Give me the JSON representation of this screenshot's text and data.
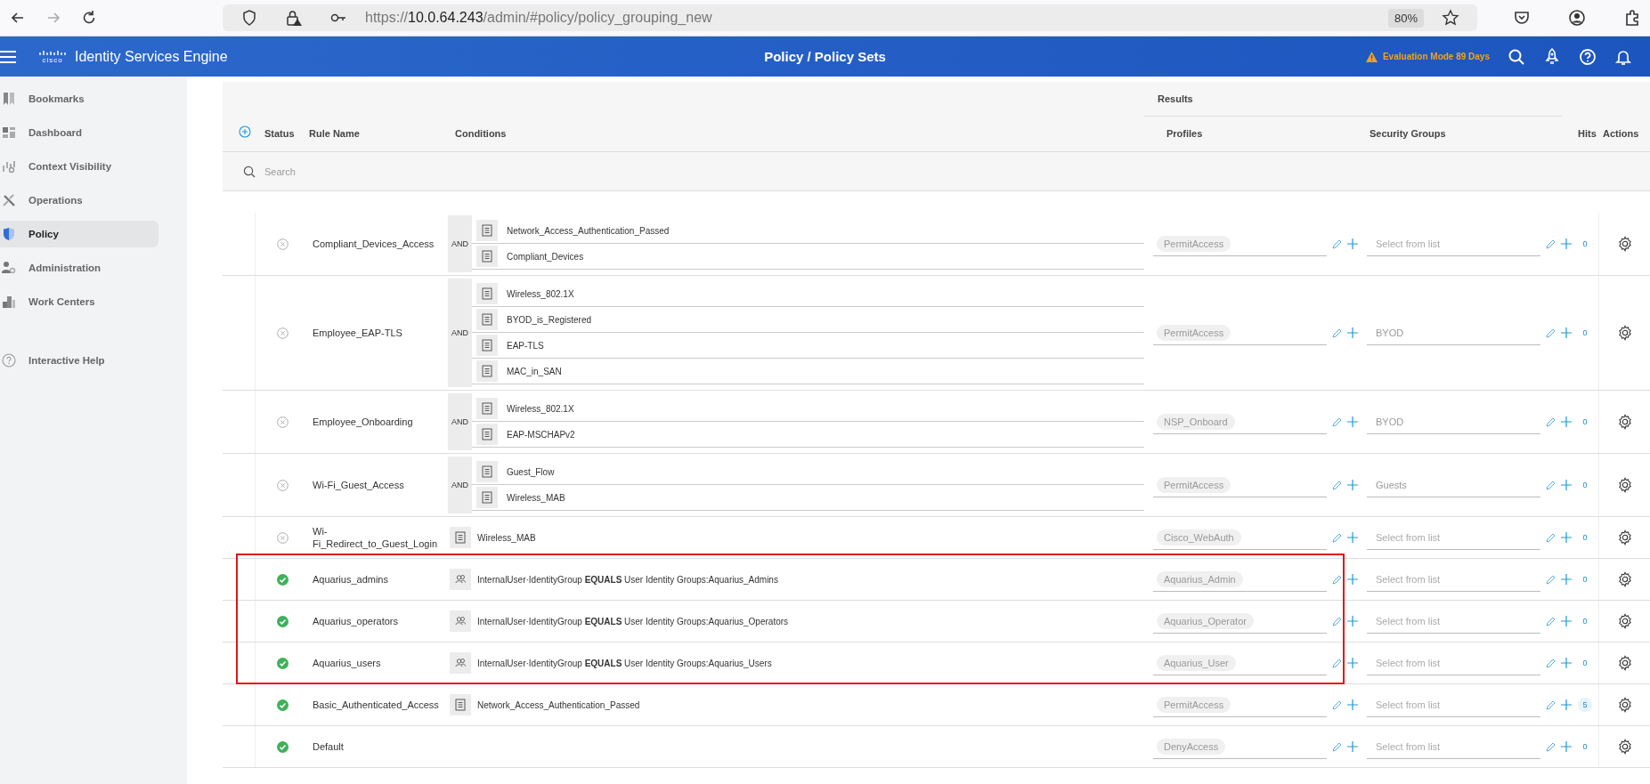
{
  "browser": {
    "url_scheme": "https://",
    "url_host": "10.0.64.243",
    "url_path": "/admin/#policy/policy_grouping_new",
    "zoom": "80%"
  },
  "header": {
    "logo_text": "cisco",
    "product": "Identity Services Engine",
    "title": "Policy / Policy Sets",
    "notice": "Evaluation Mode 89 Days"
  },
  "sidebar": {
    "items": [
      {
        "label": "Bookmarks",
        "selected": false
      },
      {
        "label": "Dashboard",
        "selected": false
      },
      {
        "label": "Context Visibility",
        "selected": false
      },
      {
        "label": "Operations",
        "selected": false
      },
      {
        "label": "Policy",
        "selected": true
      },
      {
        "label": "Administration",
        "selected": false
      },
      {
        "label": "Work Centers",
        "selected": false
      }
    ],
    "help": "Interactive Help"
  },
  "table": {
    "group_heading": "Results",
    "columns": [
      "Status",
      "Rule Name",
      "Conditions",
      "Profiles",
      "Security Groups",
      "Hits",
      "Actions"
    ],
    "search": {
      "placeholder": "Search"
    },
    "rows": [
      {
        "enabled": false,
        "highlighted": false,
        "name": "Compliant_Devices_Access",
        "conditions": {
          "kind": "and",
          "operator": "AND",
          "items": [
            "Network_Access_Authentication_Passed",
            "Compliant_Devices"
          ]
        },
        "profile": "PermitAccess",
        "security_group": {
          "placeholder": "Select from list"
        },
        "hits": "0"
      },
      {
        "enabled": false,
        "highlighted": false,
        "name": "Employee_EAP-TLS",
        "conditions": {
          "kind": "and",
          "operator": "AND",
          "items": [
            "Wireless_802.1X",
            "BYOD_is_Registered",
            "EAP-TLS",
            "MAC_in_SAN"
          ]
        },
        "profile": "PermitAccess",
        "security_group": {
          "value": "BYOD"
        },
        "hits": "0"
      },
      {
        "enabled": false,
        "highlighted": false,
        "name": "Employee_Onboarding",
        "conditions": {
          "kind": "and",
          "operator": "AND",
          "items": [
            "Wireless_802.1X",
            "EAP-MSCHAPv2"
          ]
        },
        "profile": "NSP_Onboard",
        "security_group": {
          "value": "BYOD"
        },
        "hits": "0"
      },
      {
        "enabled": false,
        "highlighted": false,
        "name": "Wi-Fi_Guest_Access",
        "conditions": {
          "kind": "and",
          "operator": "AND",
          "items": [
            "Guest_Flow",
            "Wireless_MAB"
          ]
        },
        "profile": "PermitAccess",
        "security_group": {
          "value": "Guests"
        },
        "hits": "0"
      },
      {
        "enabled": false,
        "highlighted": false,
        "name": "Wi-Fi_Redirect_to_Guest_Login",
        "conditions": {
          "kind": "single",
          "items": [
            "Wireless_MAB"
          ]
        },
        "profile": "Cisco_WebAuth",
        "security_group": {
          "placeholder": "Select from list"
        },
        "hits": "0"
      },
      {
        "enabled": true,
        "highlighted": true,
        "name": "Aquarius_admins",
        "conditions": {
          "kind": "identity",
          "text": "InternalUser·IdentityGroup **EQUALS** User Identity Groups:Aquarius_Admins"
        },
        "profile": "Aquarius_Admin",
        "security_group": {
          "placeholder": "Select from list"
        },
        "hits": "0"
      },
      {
        "enabled": true,
        "highlighted": true,
        "name": "Aquarius_operators",
        "conditions": {
          "kind": "identity",
          "text": "InternalUser·IdentityGroup **EQUALS** User Identity Groups:Aquarius_Operators"
        },
        "profile": "Aquarius_Operator",
        "security_group": {
          "placeholder": "Select from list"
        },
        "hits": "0"
      },
      {
        "enabled": true,
        "highlighted": true,
        "name": "Aquarius_users",
        "conditions": {
          "kind": "identity",
          "text": "InternalUser·IdentityGroup **EQUALS** User Identity Groups:Aquarius_Users"
        },
        "profile": "Aquarius_User",
        "security_group": {
          "placeholder": "Select from list"
        },
        "hits": "0"
      },
      {
        "enabled": true,
        "highlighted": false,
        "name": "Basic_Authenticated_Access",
        "conditions": {
          "kind": "single",
          "items": [
            "Network_Access_Authentication_Passed"
          ]
        },
        "profile": "PermitAccess",
        "security_group": {
          "placeholder": "Select from list"
        },
        "hits": "5"
      },
      {
        "enabled": true,
        "highlighted": false,
        "name": "Default",
        "profile": "DenyAccess",
        "security_group": {
          "placeholder": "Select from list"
        },
        "hits": "0"
      }
    ]
  }
}
